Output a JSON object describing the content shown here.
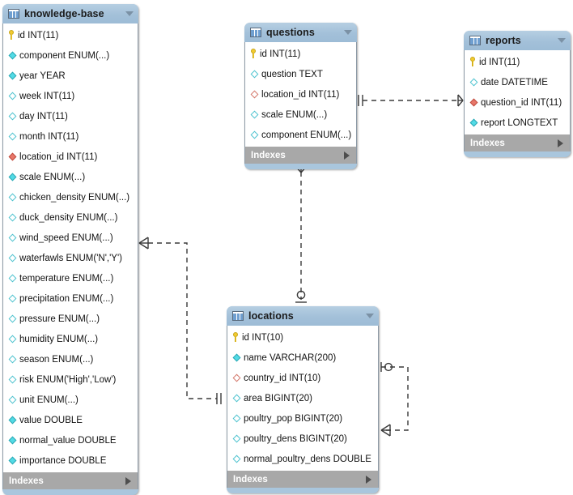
{
  "diagram": {
    "title": "EER Diagram",
    "background": "#ffffff",
    "header_color": "#a9c6dd",
    "index_bar_color": "#a8a8a8",
    "pk_color": "#f2cb2f",
    "column_color": "#52dbe6",
    "fk_color": "#e8776a"
  },
  "indexes_label": "Indexes",
  "tables": [
    {
      "id": "knowledge-base",
      "name": "knowledge-base",
      "icon": "table-icon",
      "columns": [
        {
          "label": "id INT(11)",
          "marker": "pk"
        },
        {
          "label": "component ENUM(...)",
          "marker": "col-filled"
        },
        {
          "label": "year YEAR",
          "marker": "col-filled"
        },
        {
          "label": "week INT(11)",
          "marker": "col-hollow"
        },
        {
          "label": "day INT(11)",
          "marker": "col-hollow"
        },
        {
          "label": "month INT(11)",
          "marker": "col-hollow"
        },
        {
          "label": "location_id INT(11)",
          "marker": "fk-filled"
        },
        {
          "label": "scale ENUM(...)",
          "marker": "col-filled"
        },
        {
          "label": "chicken_density ENUM(...)",
          "marker": "col-hollow"
        },
        {
          "label": "duck_density ENUM(...)",
          "marker": "col-hollow"
        },
        {
          "label": "wind_speed ENUM(...)",
          "marker": "col-hollow"
        },
        {
          "label": "waterfawls ENUM('N','Y')",
          "marker": "col-hollow"
        },
        {
          "label": "temperature ENUM(...)",
          "marker": "col-hollow"
        },
        {
          "label": "precipitation ENUM(...)",
          "marker": "col-hollow"
        },
        {
          "label": "pressure ENUM(...)",
          "marker": "col-hollow"
        },
        {
          "label": "humidity ENUM(...)",
          "marker": "col-hollow"
        },
        {
          "label": "season ENUM(...)",
          "marker": "col-hollow"
        },
        {
          "label": "risk ENUM('High','Low')",
          "marker": "col-hollow"
        },
        {
          "label": "unit ENUM(...)",
          "marker": "col-hollow"
        },
        {
          "label": "value DOUBLE",
          "marker": "col-filled"
        },
        {
          "label": "normal_value DOUBLE",
          "marker": "col-filled"
        },
        {
          "label": "importance DOUBLE",
          "marker": "col-filled"
        }
      ]
    },
    {
      "id": "questions",
      "name": "questions",
      "icon": "table-icon",
      "columns": [
        {
          "label": "id INT(11)",
          "marker": "pk"
        },
        {
          "label": "question TEXT",
          "marker": "col-hollow"
        },
        {
          "label": "location_id INT(11)",
          "marker": "fk-hollow"
        },
        {
          "label": "scale ENUM(...)",
          "marker": "col-hollow"
        },
        {
          "label": "component ENUM(...)",
          "marker": "col-hollow"
        }
      ]
    },
    {
      "id": "reports",
      "name": "reports",
      "icon": "table-icon",
      "columns": [
        {
          "label": "id INT(11)",
          "marker": "pk"
        },
        {
          "label": "date DATETIME",
          "marker": "col-hollow"
        },
        {
          "label": "question_id INT(11)",
          "marker": "fk-filled"
        },
        {
          "label": "report LONGTEXT",
          "marker": "col-filled"
        }
      ]
    },
    {
      "id": "locations",
      "name": "locations",
      "icon": "table-icon",
      "columns": [
        {
          "label": "id INT(10)",
          "marker": "pk"
        },
        {
          "label": "name VARCHAR(200)",
          "marker": "col-filled"
        },
        {
          "label": "country_id INT(10)",
          "marker": "fk-hollow"
        },
        {
          "label": "area BIGINT(20)",
          "marker": "col-hollow"
        },
        {
          "label": "poultry_pop BIGINT(20)",
          "marker": "col-hollow"
        },
        {
          "label": "poultry_dens BIGINT(20)",
          "marker": "col-hollow"
        },
        {
          "label": "normal_poultry_dens DOUBLE",
          "marker": "col-hollow"
        }
      ]
    }
  ],
  "relationships": [
    {
      "id": "rel-questions-reports",
      "from": "questions",
      "to": "reports",
      "from_cardinality": "one",
      "to_cardinality": "many",
      "style": "dashed"
    },
    {
      "id": "rel-questions-locations",
      "from": "questions",
      "to": "locations",
      "from_cardinality": "many",
      "to_cardinality": "zero-or-one",
      "style": "dashed"
    },
    {
      "id": "rel-knowledgebase-locations",
      "from": "knowledge-base",
      "to": "locations",
      "from_cardinality": "many",
      "to_cardinality": "one",
      "style": "dashed"
    },
    {
      "id": "rel-locations-locations",
      "from": "locations",
      "to": "locations",
      "from_cardinality": "zero-or-one",
      "to_cardinality": "many",
      "style": "dashed"
    }
  ]
}
